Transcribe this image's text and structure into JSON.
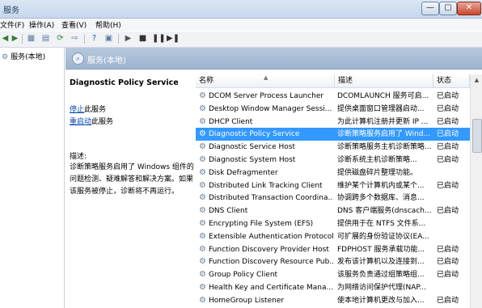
{
  "window": {
    "title": "服务",
    "min": "—",
    "max": "▢",
    "close": "✕"
  },
  "menu": [
    "文件(F)",
    "操作(A)",
    "查看(V)",
    "帮助(H)"
  ],
  "tree": {
    "label": "服务(本地)"
  },
  "header": {
    "title": "服务(本地)"
  },
  "detail": {
    "name": "Diagnostic Policy Service",
    "stop_link": "停止",
    "stop_suffix": "此服务",
    "restart_link": "重启动",
    "restart_suffix": "此服务",
    "desc_label": "描述:",
    "desc_text": "诊断策略服务启用了 Windows 组件的问题检测、疑难解答和解决方案。如果该服务被停止，诊断将不再运行。"
  },
  "columns": {
    "name": "名称",
    "desc": "描述",
    "status": "状态"
  },
  "rows": [
    {
      "name": "DCOM Server Process Launcher",
      "desc": "DCOMLAUNCH 服务可启...",
      "status": "已启动"
    },
    {
      "name": "Desktop Window Manager Sessi...",
      "desc": "提供桌面窗口管理器启动...",
      "status": "已启动"
    },
    {
      "name": "DHCP Client",
      "desc": "为此计算机注册并更新 IP ...",
      "status": "已启动"
    },
    {
      "name": "Diagnostic Policy Service",
      "desc": "诊断策略服务启用了 Wind...",
      "status": "已启动"
    },
    {
      "name": "Diagnostic Service Host",
      "desc": "诊断策略服务主机诊断策略...",
      "status": "已启动"
    },
    {
      "name": "Diagnostic System Host",
      "desc": "诊断系统主机诊断策略...",
      "status": "已启动"
    },
    {
      "name": "Disk Defragmenter",
      "desc": "提供磁盘碎片整理功能。",
      "status": ""
    },
    {
      "name": "Distributed Link Tracking Client",
      "desc": "维护某个计算机内或某个...",
      "status": "已启动"
    },
    {
      "name": "Distributed Transaction Coordina...",
      "desc": "协调跨多个数据库、消息...",
      "status": ""
    },
    {
      "name": "DNS Client",
      "desc": "DNS 客户端服务(dnscach...",
      "status": "已启动"
    },
    {
      "name": "Encrypting File System (EFS)",
      "desc": "提供用于在 NTFS 文件系...",
      "status": ""
    },
    {
      "name": "Extensible Authentication Protocol",
      "desc": "可扩展的身份验证协议(EA...",
      "status": ""
    },
    {
      "name": "Function Discovery Provider Host",
      "desc": "FDPHOST 服务承载功能...",
      "status": "已启动"
    },
    {
      "name": "Function Discovery Resource Pub...",
      "desc": "发布该计算机以及连接到...",
      "status": "已启动"
    },
    {
      "name": "Group Policy Client",
      "desc": "该服务负责通过组策略组...",
      "status": "已启动"
    },
    {
      "name": "Health Key and Certificate Mana...",
      "desc": "为网络访问保护代理(NAP...",
      "status": ""
    },
    {
      "name": "HomeGroup Listener",
      "desc": "使本地计算机更改与加入...",
      "status": "已启动"
    }
  ],
  "selected_index": 3,
  "colors": {
    "selection": "#3399ff",
    "header_band": "#a9bed6",
    "link": "#0645ad"
  }
}
